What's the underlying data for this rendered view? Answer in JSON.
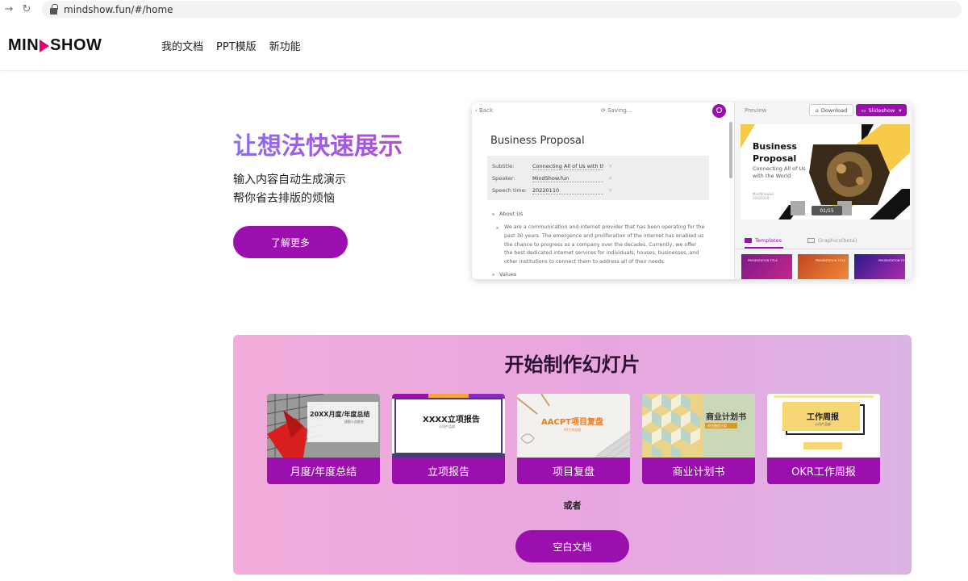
{
  "browser": {
    "url": "mindshow.fun/#/home"
  },
  "site": {
    "logo_left": "MIN",
    "logo_right": "SHOW",
    "brand_color": "#9b0fae",
    "logo_accent": "#e5007a",
    "nav": [
      "我的文档",
      "PPT模版",
      "新功能"
    ]
  },
  "hero": {
    "title": "让想法快速展示",
    "line1": "输入内容自动生成演示",
    "line2": "帮你省去排版的烦恼",
    "button": "了解更多"
  },
  "preview": {
    "back": "Back",
    "saving": "Saving...",
    "doc_title": "Business Proposal",
    "meta": [
      {
        "key": "Subtitle:",
        "value": "Connecting All of Us with th"
      },
      {
        "key": "Speaker:",
        "value": "MindShow.fun"
      },
      {
        "key": "Speech time:",
        "value": "20220110"
      }
    ],
    "section1": "About Us",
    "paragraph": "We are a communication and internet provider that has been operating for the past 30 years. The emergence and proliferation of the internet has enabled us the chance to progress as a company over the decades. Currently, we offer the best dedicated internet services for individuals, houses, businesses, and other institutions to connect them to address all of their needs.",
    "section2": "Values",
    "panel_label": "Preview",
    "download": "Download",
    "slideshow": "Slideshow",
    "slide_title": "Business Proposal",
    "slide_subtitle": "Connecting All of Us with the World",
    "slide_org": "MindShowSxl",
    "slide_date": "20220110",
    "page_indicator": "01/15",
    "tab_templates": "Templates",
    "tab_graphics": "Graphics(beta)",
    "thumb_text": [
      "PRESENTATION TITLE",
      "PRESENTATION TITLE",
      "PRESENTATION TITLE"
    ]
  },
  "start": {
    "title": "开始制作幻灯片",
    "cards": [
      {
        "label": "月度/年度总结",
        "thumb_title": "20XX月度/年度总结",
        "thumb_sub": "述职人员姓名"
      },
      {
        "label": "立项报告",
        "thumb_title": "XXXX立项报告",
        "thumb_sub": "公司产品部"
      },
      {
        "label": "项目复盘",
        "thumb_title": "AACPT项目复盘",
        "thumb_sub": "XX工作总结"
      },
      {
        "label": "商业计划书",
        "thumb_title": "商业计划书",
        "thumb_sub": "创业融资方案"
      },
      {
        "label": "OKR工作周报",
        "thumb_title": "工作周报",
        "thumb_sub": "公司产品部"
      }
    ],
    "or": "或者",
    "blank_button": "空白文档"
  }
}
